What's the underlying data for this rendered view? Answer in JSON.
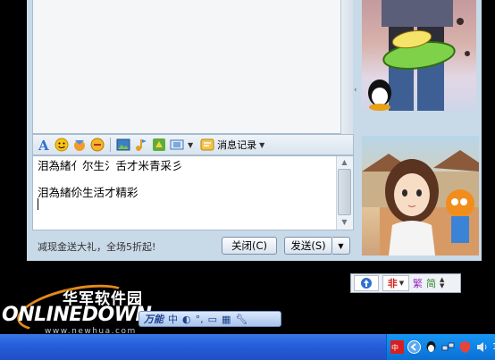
{
  "toolbar": {
    "history_label": "消息记录"
  },
  "input": {
    "line1": "泪為緒亻尔生氵舌才米青采彡",
    "line2": "泪為緒伱生活才精彩"
  },
  "bottom": {
    "promo_text": "减现金送大礼，全场5折起!",
    "close_label": "关闭(C)",
    "send_label": "发送(S)"
  },
  "ime": {
    "item1": "非",
    "item2": "繁",
    "item3": "简"
  },
  "logo": {
    "cn_text": "华军软件园",
    "en_text": "ONLINEDOWN",
    "url_text": "www.newhua.com"
  },
  "langbar": {
    "label": "万能",
    "mode": "中"
  },
  "tray": {
    "clock": "1"
  },
  "colors": {
    "frame": "#c8d9e8",
    "taskbar": "#245edb",
    "tray": "#0f83e6",
    "logo_orange": "#e48a1a"
  }
}
